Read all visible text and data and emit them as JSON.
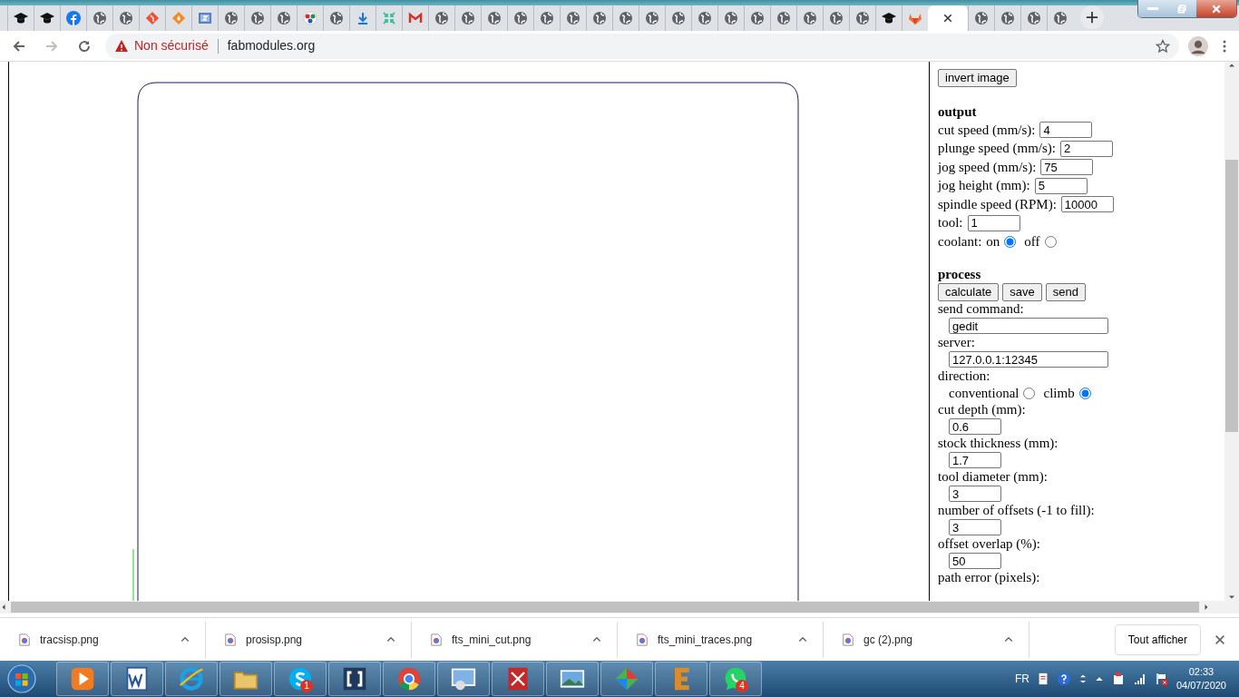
{
  "browser": {
    "tabs": [
      {
        "kind": "cap",
        "selected": false
      },
      {
        "kind": "cap",
        "selected": false
      },
      {
        "kind": "facebook",
        "selected": false
      },
      {
        "kind": "globe",
        "selected": false
      },
      {
        "kind": "globe",
        "selected": false
      },
      {
        "kind": "git",
        "selected": false
      },
      {
        "kind": "diamond",
        "selected": false
      },
      {
        "kind": "zfile",
        "selected": false
      },
      {
        "kind": "globe",
        "selected": false
      },
      {
        "kind": "globe",
        "selected": false
      },
      {
        "kind": "globe",
        "selected": false
      },
      {
        "kind": "fab",
        "selected": false
      },
      {
        "kind": "globe",
        "selected": false
      },
      {
        "kind": "download",
        "selected": false
      },
      {
        "kind": "compress",
        "selected": false
      },
      {
        "kind": "gmail",
        "selected": false
      },
      {
        "kind": "globe",
        "selected": false
      },
      {
        "kind": "globe",
        "selected": false
      },
      {
        "kind": "globe",
        "selected": false
      },
      {
        "kind": "globe",
        "selected": false
      },
      {
        "kind": "globe",
        "selected": false
      },
      {
        "kind": "globe",
        "selected": false
      },
      {
        "kind": "globe",
        "selected": false
      },
      {
        "kind": "globe",
        "selected": false
      },
      {
        "kind": "globe",
        "selected": false
      },
      {
        "kind": "globe",
        "selected": false
      },
      {
        "kind": "globe",
        "selected": false
      },
      {
        "kind": "globe",
        "selected": false
      },
      {
        "kind": "globe",
        "selected": false
      },
      {
        "kind": "globe",
        "selected": false
      },
      {
        "kind": "globe",
        "selected": false
      },
      {
        "kind": "globe",
        "selected": false
      },
      {
        "kind": "globe",
        "selected": false
      },
      {
        "kind": "cap",
        "selected": false
      },
      {
        "kind": "gitlab",
        "selected": false
      },
      {
        "kind": "blank",
        "selected": true
      },
      {
        "kind": "globe",
        "selected": false
      },
      {
        "kind": "globe",
        "selected": false
      },
      {
        "kind": "globe",
        "selected": false
      },
      {
        "kind": "globe",
        "selected": false
      }
    ],
    "address": {
      "security": "Non sécurisé",
      "url": "fabmodules.org"
    }
  },
  "panel": {
    "invert_button": "invert image",
    "output": {
      "title": "output",
      "fields": [
        {
          "kind": "inline",
          "label": "cut speed (mm/s):",
          "value": "4"
        },
        {
          "kind": "inline",
          "label": "plunge speed (mm/s):",
          "value": "2"
        },
        {
          "kind": "inline",
          "label": "jog speed (mm/s):",
          "value": "75"
        },
        {
          "kind": "inline",
          "label": "jog height (mm):",
          "value": "5"
        },
        {
          "kind": "inline",
          "label": "spindle speed (RPM):",
          "value": "10000"
        },
        {
          "kind": "inline",
          "label": "tool:",
          "value": "1"
        },
        {
          "kind": "radio_inline",
          "label": "coolant:",
          "options": [
            {
              "label": "on",
              "selected": true
            },
            {
              "label": "off",
              "selected": false
            }
          ]
        }
      ]
    },
    "process": {
      "title": "process",
      "buttons": [
        "calculate",
        "save",
        "send"
      ],
      "fields": [
        {
          "kind": "wide",
          "label": "send command:",
          "value": "gedit"
        },
        {
          "kind": "wide",
          "label": "server:",
          "value": "127.0.0.1:12345"
        },
        {
          "kind": "radio_below",
          "label": "direction:",
          "options": [
            {
              "label": "conventional",
              "selected": false
            },
            {
              "label": "climb",
              "selected": true
            }
          ]
        },
        {
          "kind": "below",
          "label": "cut depth (mm):",
          "value": "0.6"
        },
        {
          "kind": "below",
          "label": "stock thickness (mm):",
          "value": "1.7"
        },
        {
          "kind": "below",
          "label": "tool diameter (mm):",
          "value": "3"
        },
        {
          "kind": "below",
          "label": "number of offsets (-1 to fill):",
          "value": "3"
        },
        {
          "kind": "below",
          "label": "offset overlap (%):",
          "value": "50"
        },
        {
          "kind": "label",
          "label": "path error (pixels):"
        }
      ]
    }
  },
  "downloads": {
    "items": [
      "tracsisp.png",
      "prosisp.png",
      "fts_mini_cut.png",
      "fts_mini_traces.png",
      "gc (2).png"
    ],
    "show_all": "Tout afficher"
  },
  "taskbar": {
    "apps": [
      {
        "kind": "media"
      },
      {
        "kind": "word"
      },
      {
        "kind": "ie"
      },
      {
        "kind": "folder"
      },
      {
        "kind": "skype",
        "badge": "1"
      },
      {
        "kind": "brackets"
      },
      {
        "kind": "chrome"
      },
      {
        "kind": "panel"
      },
      {
        "kind": "pdf"
      },
      {
        "kind": "photo"
      },
      {
        "kind": "diamond"
      },
      {
        "kind": "e"
      },
      {
        "kind": "whatsapp",
        "badge": "4"
      }
    ],
    "tray": {
      "language": "FR",
      "time": "02:33",
      "date": "04/07/2020"
    }
  }
}
